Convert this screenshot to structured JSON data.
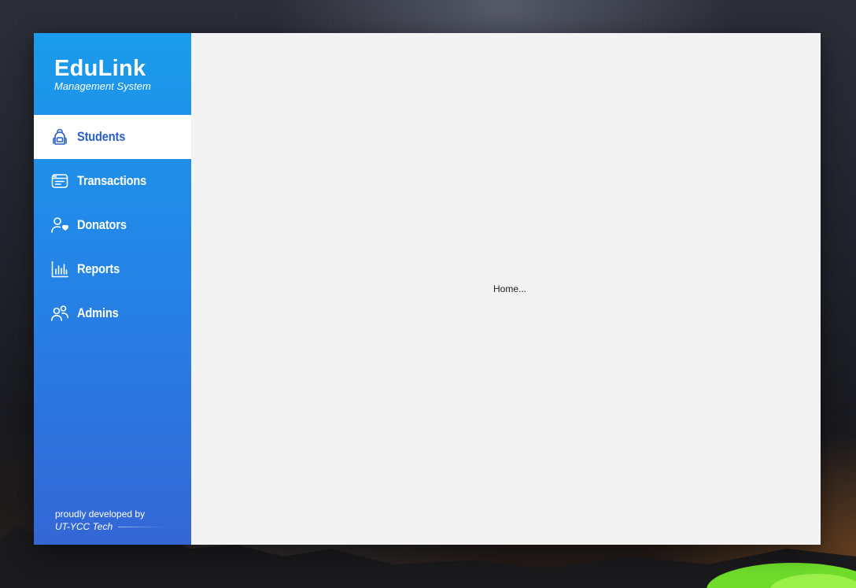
{
  "app": {
    "title": "EduLink",
    "subtitle": "Management System"
  },
  "sidebar": {
    "items": [
      {
        "label": "Students",
        "icon": "backpack-icon",
        "active": true
      },
      {
        "label": "Transactions",
        "icon": "transactions-icon",
        "active": false
      },
      {
        "label": "Donators",
        "icon": "user-heart-icon",
        "active": false
      },
      {
        "label": "Reports",
        "icon": "bar-chart-icon",
        "active": false
      },
      {
        "label": "Admins",
        "icon": "users-icon",
        "active": false
      }
    ],
    "footer": {
      "line1": "proudly developed by",
      "line2": "UT-YCC Tech"
    }
  },
  "main": {
    "placeholder": "Home..."
  },
  "colors": {
    "sidebar_top": "#1a9cec",
    "sidebar_bottom": "#3466d6",
    "active_text": "#2a5fc9",
    "content_bg": "#f3f3f3"
  }
}
